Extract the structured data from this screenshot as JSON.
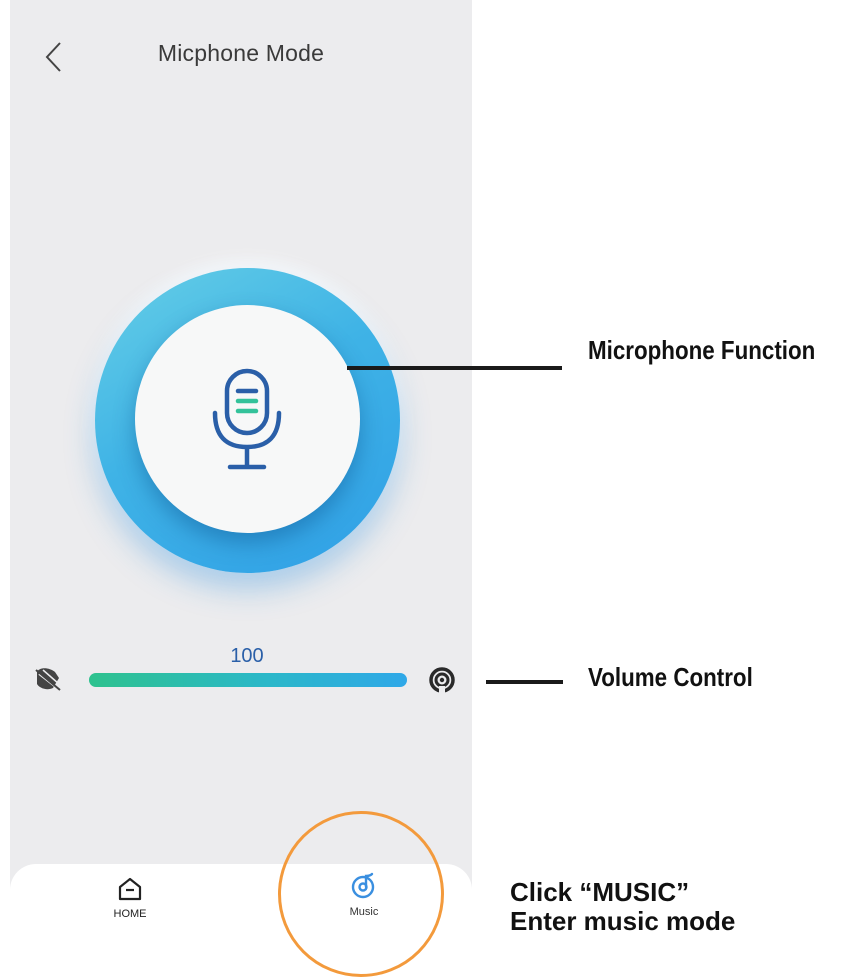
{
  "header": {
    "title": "Micphone Mode"
  },
  "volume": {
    "value_label": "100",
    "level_percent": 100
  },
  "nav": {
    "home_label": "HOME",
    "music_label": "Music"
  },
  "annotations": {
    "microphone": "Microphone Function",
    "volume": "Volume Control",
    "music_line1": "Click “MUSIC”",
    "music_line2": "Enter music mode"
  },
  "colors": {
    "ring_blue": "#3fb3e6",
    "mic_icon": "#2a5fa8",
    "mic_accent": "#33c29a",
    "slider_start": "#2ec28e",
    "slider_end": "#2fa8e8",
    "highlight": "#f39a3c",
    "music_icon": "#3a8fe0"
  },
  "icons": {
    "back": "chevron-left-icon",
    "mic": "microphone-icon",
    "vol_min": "volume-low-icon",
    "vol_max": "volume-high-icon",
    "home": "home-icon",
    "music": "music-disc-icon"
  }
}
